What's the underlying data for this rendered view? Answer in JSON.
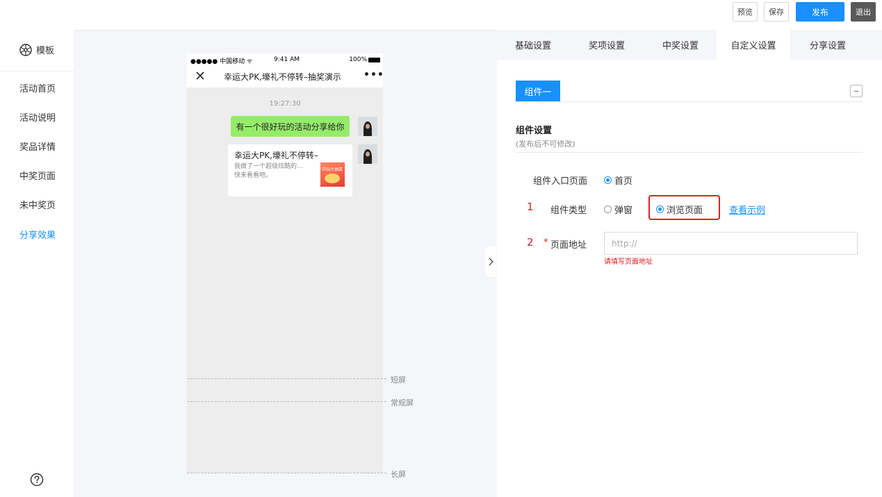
{
  "toolbar": {
    "preview": "预览",
    "save": "保存",
    "publish": "发布",
    "exit": "退出"
  },
  "sidebar": {
    "logo_label": "模板",
    "items": [
      {
        "label": "活动首页"
      },
      {
        "label": "活动说明"
      },
      {
        "label": "奖品详情"
      },
      {
        "label": "中奖页面"
      },
      {
        "label": "未中奖页"
      },
      {
        "label": "分享效果",
        "active": true
      }
    ]
  },
  "phone": {
    "carrier": "●●●●● 中国移动 ᯤ",
    "time": "9:41 AM",
    "battery": "100%",
    "nav_title": "幸运大PK,壕礼不停转–抽奖演示",
    "chat_time": "19:27:30",
    "message": "有一个很好玩的活动分享给你",
    "card_title": "幸运大PK,壕礼不停转–",
    "card_desc_1": "我做了一个超级炫酷的…",
    "card_desc_2": "快来看看吧。",
    "thumb_text": "中玩大抽奖"
  },
  "screens": {
    "short": "短屏",
    "normal": "常规屏",
    "long": "长屏"
  },
  "tabs": [
    {
      "label": "基础设置"
    },
    {
      "label": "奖项设置"
    },
    {
      "label": "中奖设置"
    },
    {
      "label": "自定义设置",
      "active": true
    },
    {
      "label": "分享设置"
    }
  ],
  "component": {
    "tab_label": "组件一",
    "collapse": "−",
    "section_title": "组件设置",
    "section_sub": "(发布后不可修改)",
    "entry_label": "组件入口页面",
    "entry_option": "首页",
    "type_num": "1",
    "type_label": "组件类型",
    "type_option_popup": "弹窗",
    "type_option_browse": "浏览页面",
    "example_link": "查看示例",
    "url_num": "2",
    "url_required": "*",
    "url_label": "页面地址",
    "url_placeholder": "http://",
    "url_error": "请填写页面地址"
  },
  "colors": {
    "accent": "#1890ff",
    "error": "#e02020",
    "chat_bubble": "#95ec69"
  }
}
